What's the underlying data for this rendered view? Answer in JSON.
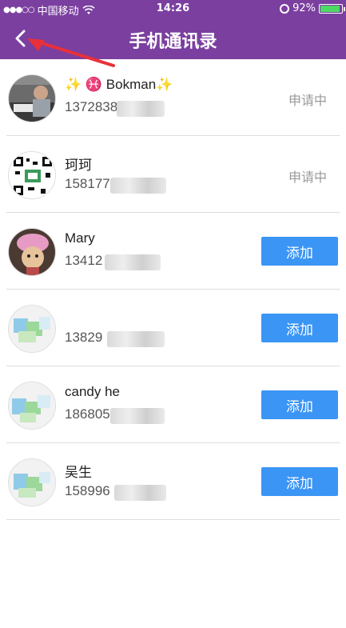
{
  "status_bar": {
    "carrier": "中国移动",
    "time": "14:26",
    "battery": "92%",
    "battery_level": 0.92,
    "signal_icon": "signal-dots-icon",
    "wifi_icon": "wifi-icon"
  },
  "nav": {
    "title": "手机通讯录",
    "back_icon": "chevron-left-icon"
  },
  "contacts": [
    {
      "name": "✨ ♓ Bokman✨",
      "phone": "1372838",
      "action": "申请中",
      "action_type": "status"
    },
    {
      "name": "珂珂",
      "phone": "158177",
      "action": "申请中",
      "action_type": "status"
    },
    {
      "name": "Mary",
      "phone": "13412",
      "action": "添加",
      "action_type": "button"
    },
    {
      "name": "",
      "phone": "13829",
      "action": "添加",
      "action_type": "button"
    },
    {
      "name": "candy he",
      "phone": "186805",
      "action": "添加",
      "action_type": "button"
    },
    {
      "name": "吴生",
      "phone": "158996",
      "action": "添加",
      "action_type": "button"
    }
  ],
  "colors": {
    "header": "#7b3fa0",
    "button": "#3b95f5",
    "annotation_arrow": "#e8303a"
  }
}
